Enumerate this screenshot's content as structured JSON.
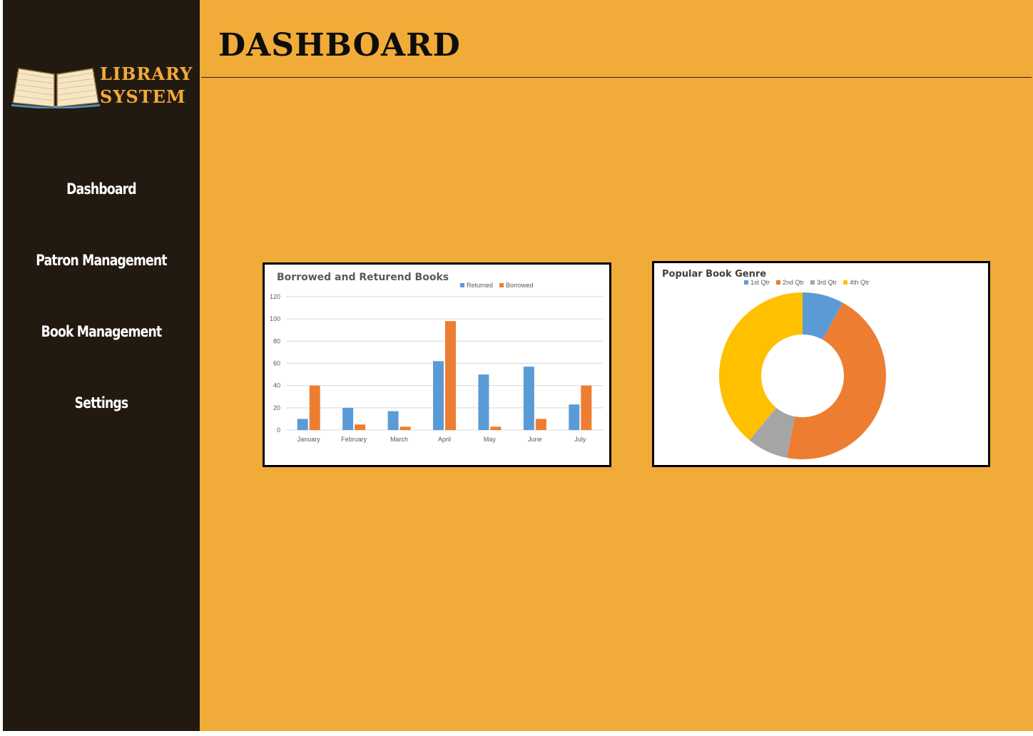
{
  "logo": {
    "line1": "LIBRARY",
    "line2": "SYSTEM",
    "icon": "open-book-icon"
  },
  "nav": [
    {
      "label": "Dashboard"
    },
    {
      "label": "Patron Management"
    },
    {
      "label": "Book Management"
    },
    {
      "label": "Settings"
    }
  ],
  "page": {
    "title": "DASHBOARD"
  },
  "colors": {
    "sidebar": "#221a10",
    "main": "#f1ab38",
    "accent": "#f1ab38",
    "blue": "#5b9bd5",
    "orange": "#ed7d31",
    "gray": "#a5a5a5",
    "yellow": "#ffc000"
  },
  "chart_data": [
    {
      "type": "bar",
      "title": "Borrowed and Returend Books",
      "categories": [
        "January",
        "February",
        "March",
        "April",
        "May",
        "June",
        "July"
      ],
      "series": [
        {
          "name": "Returned",
          "values": [
            10,
            20,
            17,
            62,
            50,
            57,
            23
          ],
          "color": "#5b9bd5"
        },
        {
          "name": "Borrowed",
          "values": [
            40,
            5,
            3,
            98,
            3,
            10,
            40
          ],
          "color": "#ed7d31"
        }
      ],
      "ylim": [
        0,
        120
      ],
      "yticks": [
        0,
        20,
        40,
        60,
        80,
        100,
        120
      ],
      "grid": true,
      "legend": "top-right"
    },
    {
      "type": "pie",
      "donut": true,
      "title": "Popular Book Genre",
      "labels": [
        "1st Qtr",
        "2nd Qtr",
        "3rd Qtr",
        "4th Qtr"
      ],
      "values": [
        8,
        45,
        8,
        39
      ],
      "colors": [
        "#5b9bd5",
        "#ed7d31",
        "#a5a5a5",
        "#ffc000"
      ],
      "legend": "top"
    }
  ]
}
